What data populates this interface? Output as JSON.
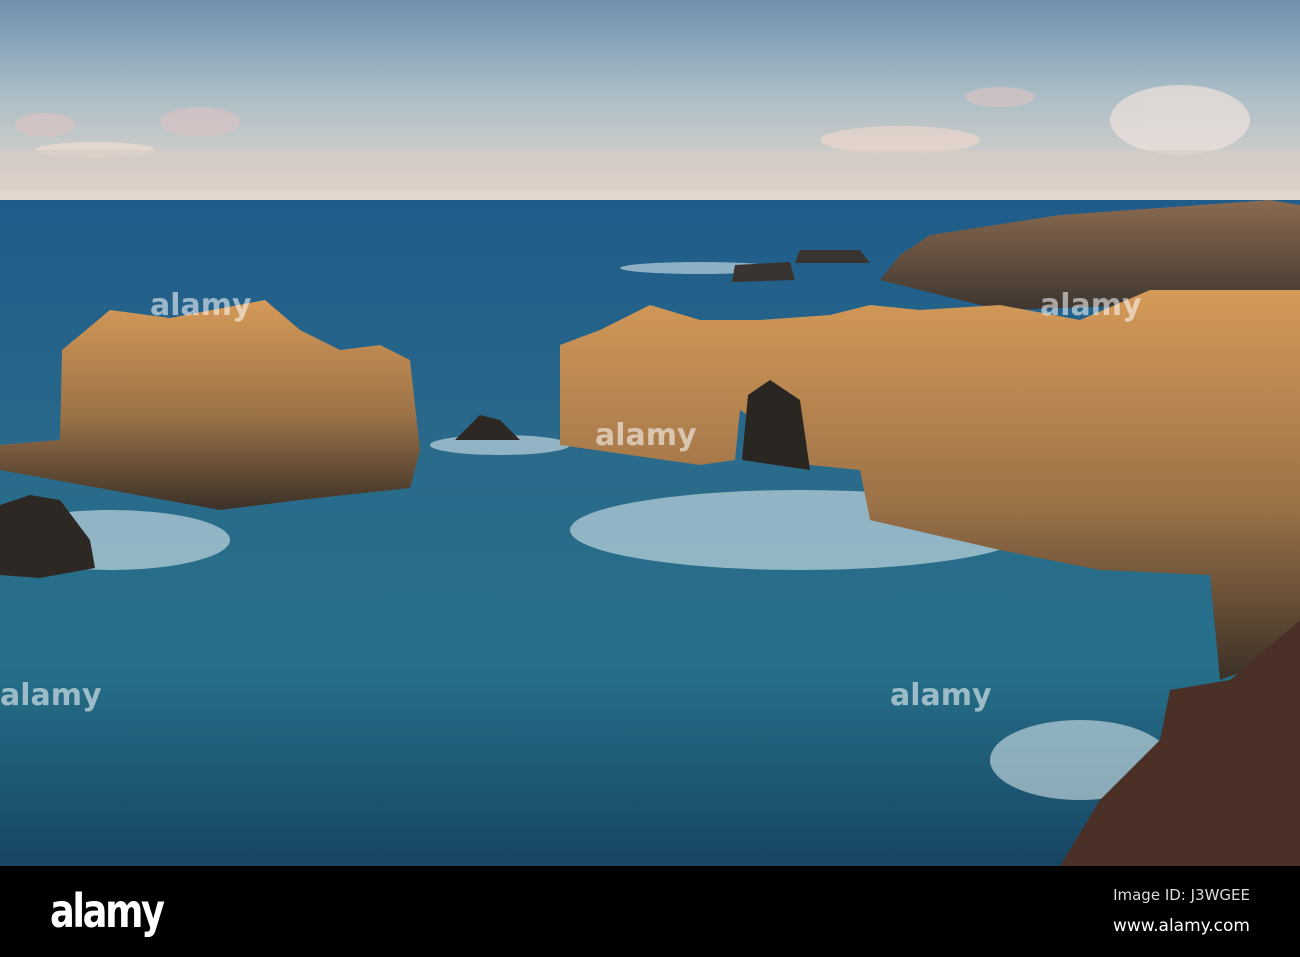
{
  "watermark": {
    "logo": "alamy",
    "image_id": "Image ID: J3WGEE",
    "site": "www.alamy.com",
    "overlay_text": "alamy"
  },
  "colors": {
    "sky_top": "#6f90ae",
    "sky_horizon": "#e8dccf",
    "sea_far": "#1d5a86",
    "sea_near": "#1b4d6b",
    "rock_lit": "#c98e4e",
    "rock_shadow": "#3d3328"
  }
}
